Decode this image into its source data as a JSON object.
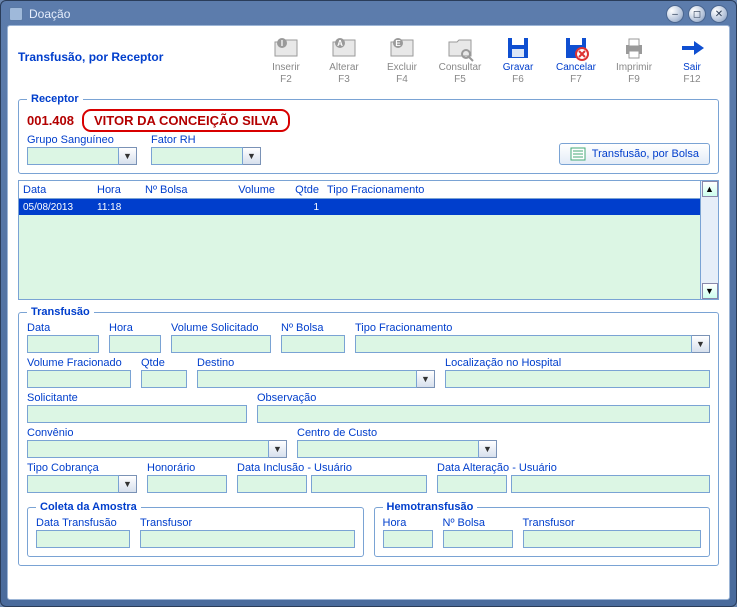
{
  "window": {
    "title": "Doação"
  },
  "header": {
    "title": "Transfusão, por Receptor"
  },
  "toolbar": [
    {
      "key": "inserir",
      "label": "Inserir",
      "fkey": "F2",
      "active": false,
      "icon": "folder-i"
    },
    {
      "key": "alterar",
      "label": "Alterar",
      "fkey": "F3",
      "active": false,
      "icon": "folder-a"
    },
    {
      "key": "excluir",
      "label": "Excluir",
      "fkey": "F4",
      "active": false,
      "icon": "folder-e"
    },
    {
      "key": "consultar",
      "label": "Consultar",
      "fkey": "F5",
      "active": false,
      "icon": "folder-search"
    },
    {
      "key": "gravar",
      "label": "Gravar",
      "fkey": "F6",
      "active": true,
      "icon": "floppy"
    },
    {
      "key": "cancelar",
      "label": "Cancelar",
      "fkey": "F7",
      "active": true,
      "icon": "floppy-x"
    },
    {
      "key": "imprimir",
      "label": "Imprimir",
      "fkey": "F9",
      "active": false,
      "icon": "printer"
    },
    {
      "key": "sair",
      "label": "Sair",
      "fkey": "F12",
      "active": true,
      "icon": "arrow-right"
    }
  ],
  "receptor": {
    "legend": "Receptor",
    "id": "001.408",
    "name": "VITOR DA CONCEIÇÃO SILVA",
    "grupo_label": "Grupo Sanguíneo",
    "fator_label": "Fator RH",
    "grupo_value": "",
    "fator_value": "",
    "btn_bolsa": "Transfusão, por Bolsa"
  },
  "grid": {
    "headers": {
      "data": "Data",
      "hora": "Hora",
      "bolsa": "Nº Bolsa",
      "volume": "Volume",
      "qtde": "Qtde",
      "tipo": "Tipo Fracionamento"
    },
    "rows": [
      {
        "data": "05/08/2013",
        "hora": "11:18",
        "bolsa": "",
        "volume": "",
        "qtde": "1",
        "tipo": ""
      }
    ]
  },
  "transfusao": {
    "legend": "Transfusão",
    "labels": {
      "data": "Data",
      "hora": "Hora",
      "vol_sol": "Volume Solicitado",
      "n_bolsa": "Nº Bolsa",
      "tipo_frac": "Tipo Fracionamento",
      "vol_frac": "Volume Fracionado",
      "qtde": "Qtde",
      "destino": "Destino",
      "loc_hosp": "Localização no Hospital",
      "solicitante": "Solicitante",
      "obs": "Observação",
      "convenio": "Convênio",
      "centro": "Centro de Custo",
      "tipo_cob": "Tipo Cobrança",
      "honorario": "Honorário",
      "data_inc": "Data Inclusão - Usuário",
      "data_alt": "Data Alteração - Usuário"
    },
    "values": {
      "data": "",
      "hora": "",
      "vol_sol": "",
      "n_bolsa": "",
      "tipo_frac": "",
      "vol_frac": "",
      "qtde": "",
      "destino": "",
      "loc_hosp": "",
      "solicitante": "",
      "obs": "",
      "convenio": "",
      "centro": "",
      "tipo_cob": "",
      "honorario": "",
      "data_inc": "",
      "data_inc_user": "",
      "data_alt": "",
      "data_alt_user": ""
    }
  },
  "coleta": {
    "legend": "Coleta da Amostra",
    "labels": {
      "data": "Data Transfusão",
      "transfusor": "Transfusor"
    },
    "values": {
      "data": "",
      "transfusor": ""
    }
  },
  "hemo": {
    "legend": "Hemotransfusão",
    "labels": {
      "hora": "Hora",
      "n_bolsa": "Nº Bolsa",
      "transfusor": "Transfusor"
    },
    "values": {
      "hora": "",
      "n_bolsa": "",
      "transfusor": ""
    }
  }
}
